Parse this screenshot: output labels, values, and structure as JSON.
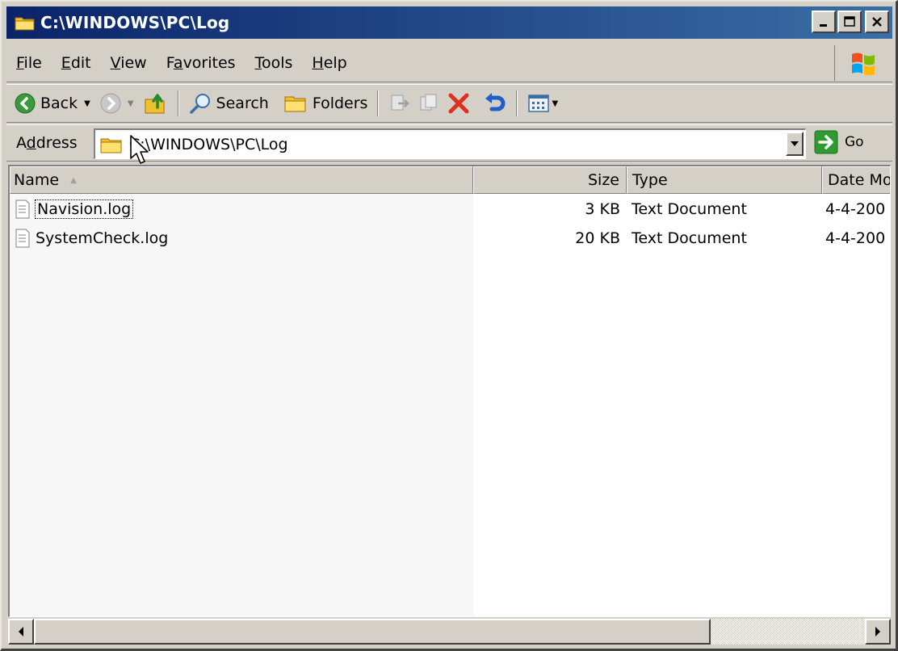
{
  "window": {
    "title": "C:\\WINDOWS\\PC\\Log",
    "icon": "folder-icon",
    "buttons": [
      "minimize-icon",
      "maximize-icon",
      "close-icon"
    ]
  },
  "menu": {
    "items": [
      {
        "key": "F",
        "rest": "ile"
      },
      {
        "key": "E",
        "rest": "dit"
      },
      {
        "key": "V",
        "rest": "iew"
      },
      {
        "pre": "F",
        "key": "a",
        "rest": "vorites"
      },
      {
        "key": "T",
        "rest": "ools"
      },
      {
        "key": "H",
        "rest": "elp"
      }
    ]
  },
  "toolbar": {
    "back_label": "Back",
    "search_label": "Search",
    "folders_label": "Folders",
    "icons": [
      "back-icon",
      "forward-icon",
      "up-folder-icon",
      "search-icon",
      "folders-icon",
      "move-to-icon",
      "copy-to-icon",
      "delete-icon",
      "undo-icon",
      "views-icon"
    ]
  },
  "address": {
    "label_pre": "A",
    "label_key": "d",
    "label_rest": "dress",
    "value": "C:\\WINDOWS\\PC\\Log",
    "go_label": "Go"
  },
  "list": {
    "columns": {
      "name": "Name",
      "size": "Size",
      "type": "Type",
      "date": "Date Mo"
    },
    "rows": [
      {
        "name": "Navision.log",
        "size": "3 KB",
        "type": "Text Document",
        "date": "4-4-200"
      },
      {
        "name": "SystemCheck.log",
        "size": "20 KB",
        "type": "Text Document",
        "date": "4-4-200"
      }
    ]
  },
  "colors": {
    "titlebar": "#0a246a",
    "face": "#d4d0c8",
    "delete_red": "#e03020",
    "go_green": "#2f9a2f"
  }
}
